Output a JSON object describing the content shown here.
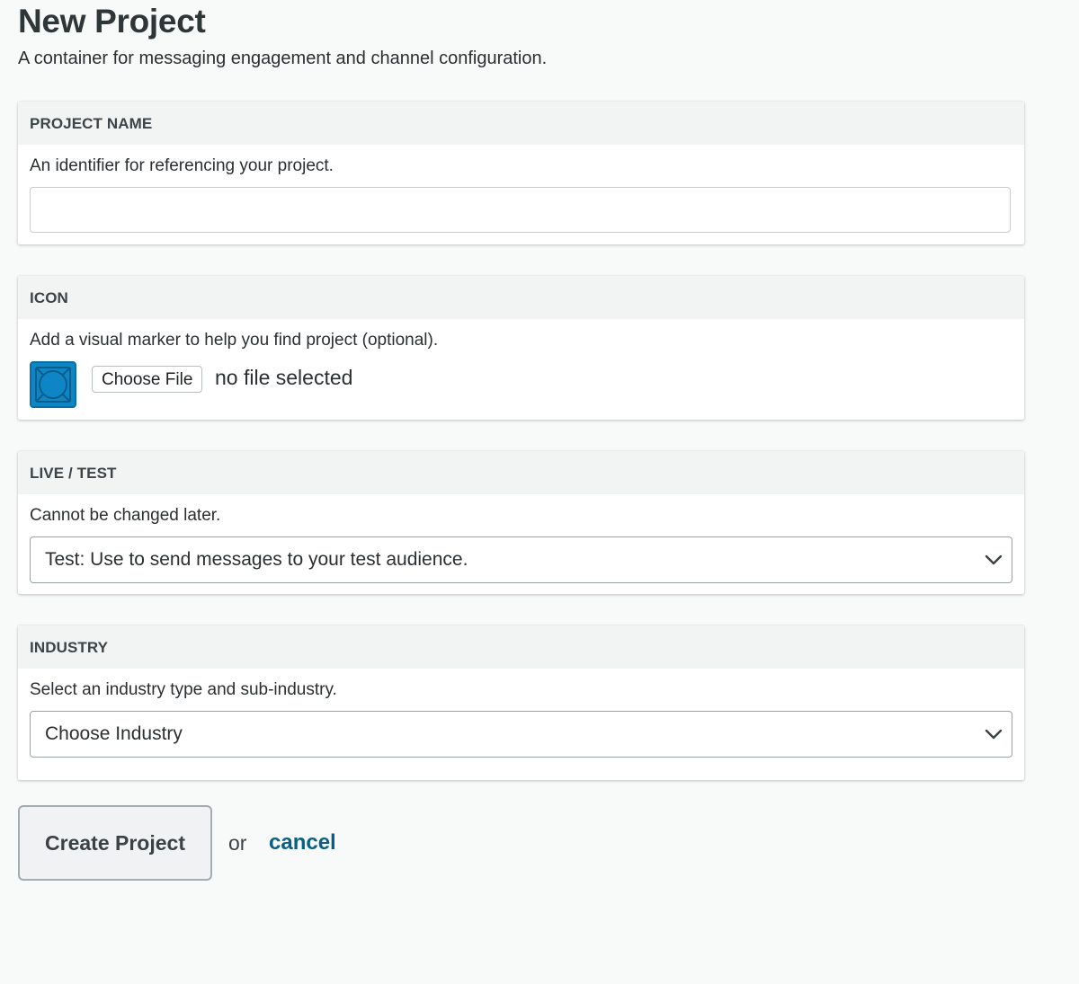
{
  "header": {
    "title": "New Project",
    "subtitle": "A container for messaging engagement and channel configuration."
  },
  "project_name": {
    "heading": "PROJECT NAME",
    "description": "An identifier for referencing your project.",
    "value": "",
    "placeholder": ""
  },
  "icon": {
    "heading": "ICON",
    "description": "Add a visual marker to help you find project (optional).",
    "choose_file_label": "Choose File",
    "file_status": "no file selected",
    "preview_color": "#0e86c6"
  },
  "live_test": {
    "heading": "LIVE / TEST",
    "description": "Cannot be changed later.",
    "selected": "Test: Use to send messages to your test audience."
  },
  "industry": {
    "heading": "INDUSTRY",
    "description": "Select an industry type and sub-industry.",
    "selected": "Choose Industry"
  },
  "actions": {
    "create_label": "Create Project",
    "or_text": "or",
    "cancel_label": "cancel",
    "link_color": "#0b5f86"
  }
}
